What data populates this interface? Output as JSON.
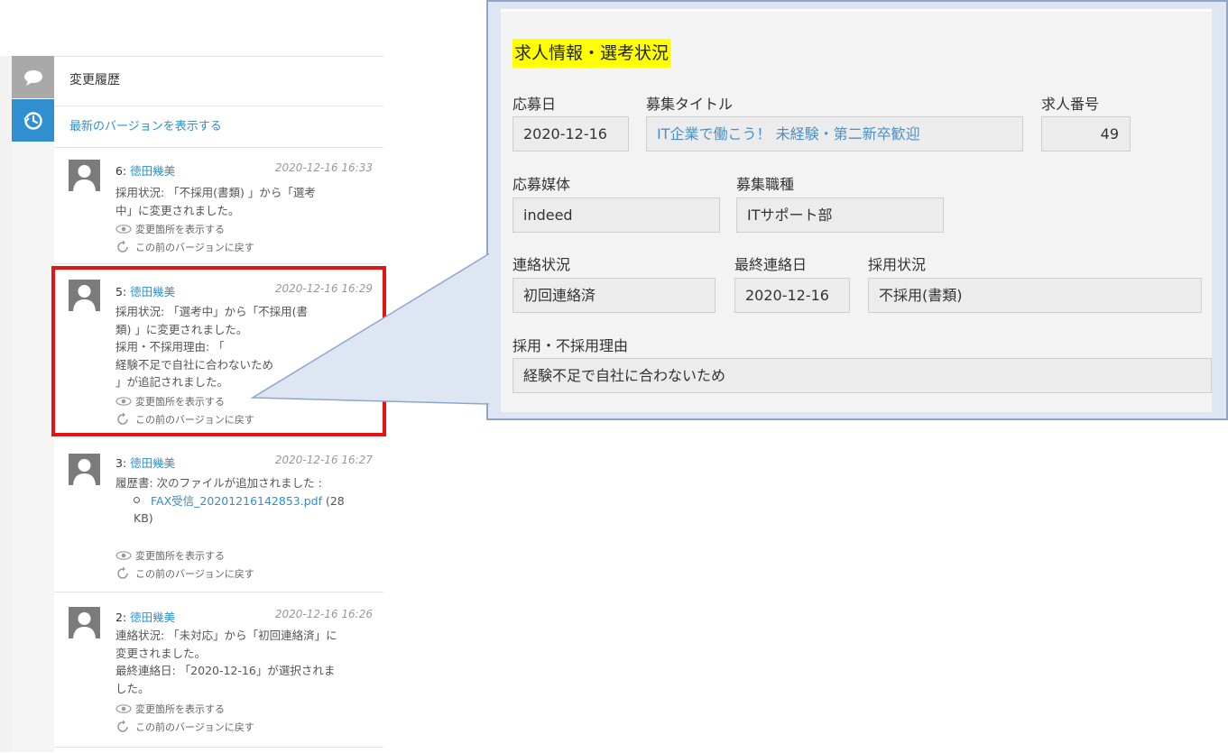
{
  "panel": {
    "title": "変更履歴",
    "latest_link": "最新のバージョンを表示する"
  },
  "actions": {
    "show_changes": "変更箇所を表示する",
    "revert": "この前のバージョンに戻す"
  },
  "entries": [
    {
      "version": "6:",
      "user": "徳田幾美",
      "timestamp": "2020-12-16 16:33",
      "text": "採用状況: 「不採用(書類) 」から「選考\n中」に変更されました。"
    },
    {
      "version": "5:",
      "user": "徳田幾美",
      "timestamp": "2020-12-16 16:29",
      "text": "採用状況: 「選考中」から「不採用(書\n類) 」に変更されました。\n採用・不採用理由: 「\n経験不足で自社に合わないため\n」が追記されました。"
    },
    {
      "version": "3:",
      "user": "徳田幾美",
      "timestamp": "2020-12-16 16:27",
      "text": "履歴書: 次のファイルが追加されました :",
      "file_name": "FAX受信_20201216142853.pdf",
      "file_size": " (28\nKB)"
    },
    {
      "version": "2:",
      "user": "徳田幾美",
      "timestamp": "2020-12-16 16:26",
      "text": "連絡状況: 「未対応」から「初回連絡済」に\n変更されました。\n最終連絡日: 「2020-12-16」が選択されま\nした。"
    }
  ],
  "form": {
    "section_title": "求人情報・選考状況",
    "fields": {
      "apply_date": {
        "label": "応募日",
        "value": "2020-12-16"
      },
      "job_title": {
        "label": "募集タイトル",
        "value": "IT企業で働こう！ 未経験・第二新卒歓迎"
      },
      "job_number": {
        "label": "求人番号",
        "value": "49"
      },
      "media": {
        "label": "応募媒体",
        "value": "indeed"
      },
      "job_type": {
        "label": "募集職種",
        "value": "ITサポート部"
      },
      "contact_status": {
        "label": "連絡状況",
        "value": "初回連絡済"
      },
      "last_contact": {
        "label": "最終連絡日",
        "value": "2020-12-16"
      },
      "hire_status": {
        "label": "採用状況",
        "value": "不採用(書類)"
      },
      "reason": {
        "label": "採用・不採用理由",
        "value": "経験不足で自社に合わないため"
      }
    }
  },
  "colors": {
    "link": "#2f8fd1",
    "highlight_border": "#e31414",
    "title_marker": "#ffff00",
    "callout_fill": "#dfe6f3"
  }
}
